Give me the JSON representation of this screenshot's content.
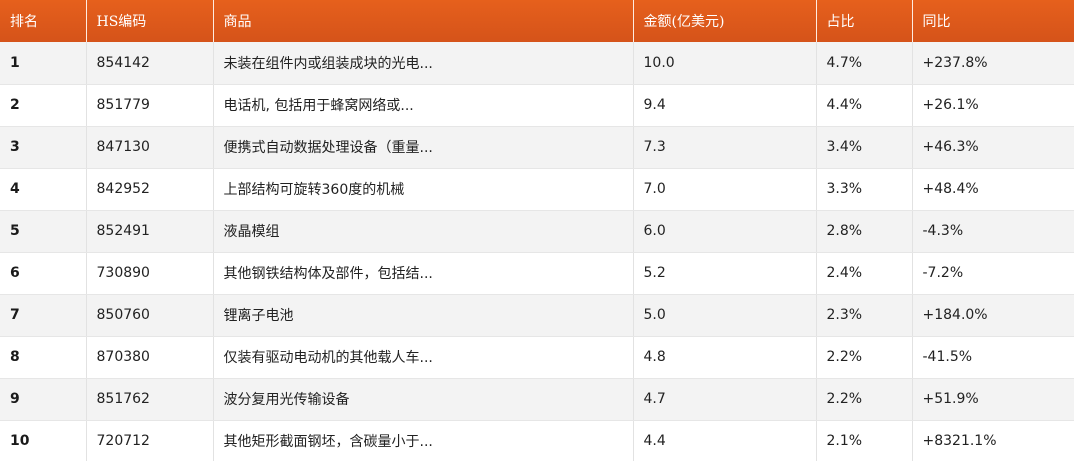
{
  "table": {
    "headers": [
      "排名",
      "HS编码",
      "商品",
      "金额(亿美元)",
      "占比",
      "同比"
    ],
    "rows": [
      {
        "rank": "1",
        "hs": "854142",
        "name": "未装在组件内或组装成块的光电...",
        "amount": "10.0",
        "share": "4.7%",
        "yoy": "+237.8%"
      },
      {
        "rank": "2",
        "hs": "851779",
        "name": "电话机, 包括用于蜂窝网络或...",
        "amount": "9.4",
        "share": "4.4%",
        "yoy": "+26.1%"
      },
      {
        "rank": "3",
        "hs": "847130",
        "name": "便携式自动数据处理设备（重量...",
        "amount": "7.3",
        "share": "3.4%",
        "yoy": "+46.3%"
      },
      {
        "rank": "4",
        "hs": "842952",
        "name": "上部结构可旋转360度的机械",
        "amount": "7.0",
        "share": "3.3%",
        "yoy": "+48.4%"
      },
      {
        "rank": "5",
        "hs": "852491",
        "name": "液晶模组",
        "amount": "6.0",
        "share": "2.8%",
        "yoy": "-4.3%"
      },
      {
        "rank": "6",
        "hs": "730890",
        "name": "其他钢铁结构体及部件，包括结...",
        "amount": "5.2",
        "share": "2.4%",
        "yoy": "-7.2%"
      },
      {
        "rank": "7",
        "hs": "850760",
        "name": "锂离子电池",
        "amount": "5.0",
        "share": "2.3%",
        "yoy": "+184.0%"
      },
      {
        "rank": "8",
        "hs": "870380",
        "name": "仅装有驱动电动机的其他载人车...",
        "amount": "4.8",
        "share": "2.2%",
        "yoy": "-41.5%"
      },
      {
        "rank": "9",
        "hs": "851762",
        "name": "波分复用光传输设备",
        "amount": "4.7",
        "share": "2.2%",
        "yoy": "+51.9%"
      },
      {
        "rank": "10",
        "hs": "720712",
        "name": "其他矩形截面钢坯，含碳量小于...",
        "amount": "4.4",
        "share": "2.1%",
        "yoy": "+8321.1%"
      }
    ]
  },
  "colors": {
    "header_bg": "#e05a1b",
    "header_text": "#ffffff",
    "row_alt_bg": "#f3f3f3"
  }
}
